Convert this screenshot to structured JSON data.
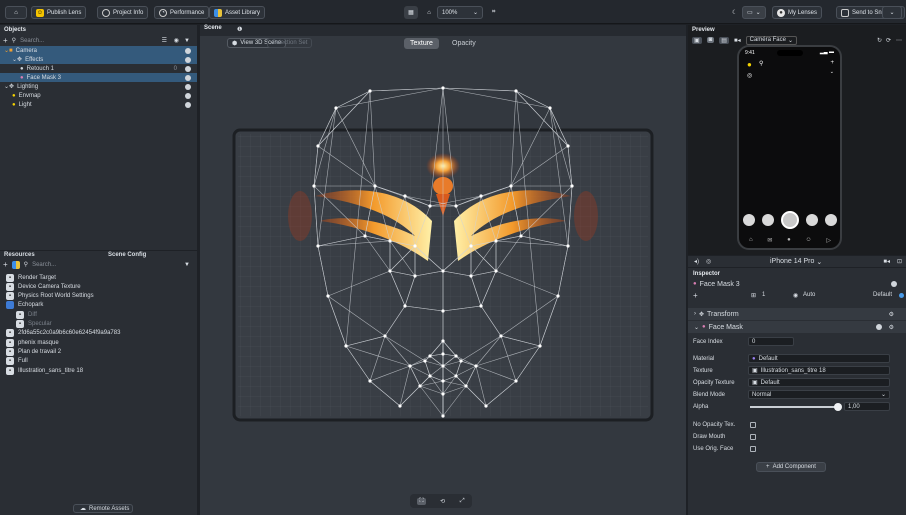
{
  "toolbar": {
    "publish_label": "Publish Lens",
    "project_info_label": "Project Info",
    "performance_label": "Performance",
    "asset_library_label": "Asset Library",
    "zoom_value": "100%",
    "my_lenses_label": "My Lenses",
    "send_label": "Send to Snapchat"
  },
  "objects": {
    "title": "Objects",
    "search_placeholder": "Search...",
    "items": [
      {
        "label": "Camera",
        "indent": 0,
        "selected": true
      },
      {
        "label": "Effects",
        "indent": 1,
        "selected": true
      },
      {
        "label": "Retouch 1",
        "indent": 2,
        "selected": false,
        "count": "0"
      },
      {
        "label": "Face Mask 3",
        "indent": 2,
        "selected": true
      },
      {
        "label": "Lighting",
        "indent": 0,
        "selected": false
      },
      {
        "label": "Envmap",
        "indent": 1,
        "selected": false
      },
      {
        "label": "Light",
        "indent": 1,
        "selected": false
      }
    ]
  },
  "resources": {
    "tab_resources": "Resources",
    "tab_scene_config": "Scene Config",
    "search_placeholder": "Search...",
    "items": [
      {
        "label": "Render Target",
        "indent": 0,
        "dim": false
      },
      {
        "label": "Device Camera Texture",
        "indent": 0,
        "dim": false
      },
      {
        "label": "Physics Root World Settings",
        "indent": 0,
        "dim": false
      },
      {
        "label": "Echopark",
        "indent": 0,
        "dim": false
      },
      {
        "label": "Diff",
        "indent": 1,
        "dim": true
      },
      {
        "label": "Specular",
        "indent": 1,
        "dim": true
      },
      {
        "label": "2fd6a55c2c0a9b6c60e62454f9a9a783",
        "indent": 0,
        "dim": false
      },
      {
        "label": "phenix masque",
        "indent": 0,
        "dim": false
      },
      {
        "label": "Plan de travail 2",
        "indent": 0,
        "dim": false
      },
      {
        "label": "Full",
        "indent": 0,
        "dim": false
      },
      {
        "label": "Illustration_sans_titre 18",
        "indent": 0,
        "dim": false
      }
    ],
    "remote_assets_label": "Remote Assets"
  },
  "scene": {
    "title": "Scene",
    "view_3d_label": "View 3D Scene",
    "selection_set_label": "Selection Set",
    "tab_texture": "Texture",
    "tab_opacity": "Opacity"
  },
  "preview": {
    "title": "Preview",
    "camera_label": "Caméra Face",
    "phone_time": "9:41",
    "device_label": "iPhone 14 Pro"
  },
  "inspector": {
    "title": "Inspector",
    "object_name": "Face Mask 3",
    "layer_count": "1",
    "auto_label": "Auto",
    "default_label": "Default",
    "transform_label": "Transform",
    "face_mask_label": "Face Mask",
    "face_index_label": "Face Index",
    "face_index_value": "0",
    "material_label": "Material",
    "material_value": "Default",
    "texture_label": "Texture",
    "texture_value": "Illustration_sans_titre 18",
    "opacity_texture_label": "Opacity Texture",
    "opacity_texture_value": "Default",
    "blend_mode_label": "Blend Mode",
    "blend_mode_value": "Normal",
    "alpha_label": "Alpha",
    "alpha_value": "1,00",
    "no_opacity_label": "No Opacity Tex.",
    "draw_mouth_label": "Draw Mouth",
    "use_orig_face_label": "Use Orig. Face",
    "add_component_label": "Add Component"
  }
}
